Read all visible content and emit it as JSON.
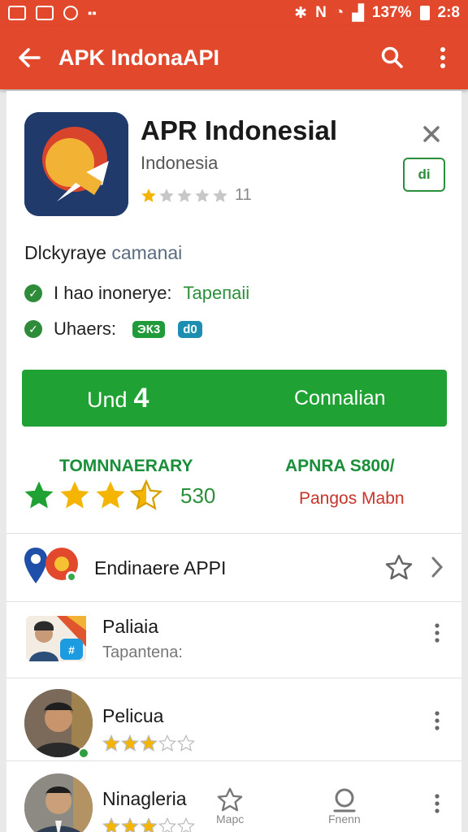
{
  "status_bar": {
    "battery": "137%",
    "time": "2:8"
  },
  "toolbar": {
    "title": "APK IndonaAPI",
    "back_icon": "arrow-left-icon",
    "search_icon": "search-icon",
    "menu_icon": "more-vert-icon"
  },
  "app": {
    "title": "APR Indonesial",
    "subtitle": "Indonesia",
    "rating_count": "11",
    "rating_value": 1,
    "tag_label": "di"
  },
  "description": {
    "prefix": "Dlckyraye",
    "accent": "camanai"
  },
  "checks": [
    {
      "label": "I hao inonerye:",
      "value": "Tapeпаii"
    },
    {
      "label": "Uhaers:",
      "pill_1": "ЭК3",
      "pill_2": "d0"
    }
  ],
  "install": {
    "left_label": "Und",
    "left_number": "4",
    "right_label": "Connalian"
  },
  "summary": {
    "left_label": "TOMNNAERARY",
    "right_label": "APNRA S800/",
    "right_sub": "Pangos Mabn",
    "count": "530",
    "stars_value": 3.5
  },
  "list": [
    {
      "title": "Endinaere APPI"
    },
    {
      "title": "Paliaia",
      "subtitle": "Tapantena:"
    },
    {
      "title": "Pelicua",
      "rating": 3
    },
    {
      "title": "Ninagleria",
      "rating": 3
    }
  ],
  "bottom_nav": [
    {
      "label": "Mapc",
      "icon": "star-outline-icon"
    },
    {
      "label": "Fnenn",
      "icon": "profile-icon"
    }
  ],
  "colors": {
    "accent": "#e2482c",
    "green": "#1fa233",
    "star": "#f4b400"
  }
}
